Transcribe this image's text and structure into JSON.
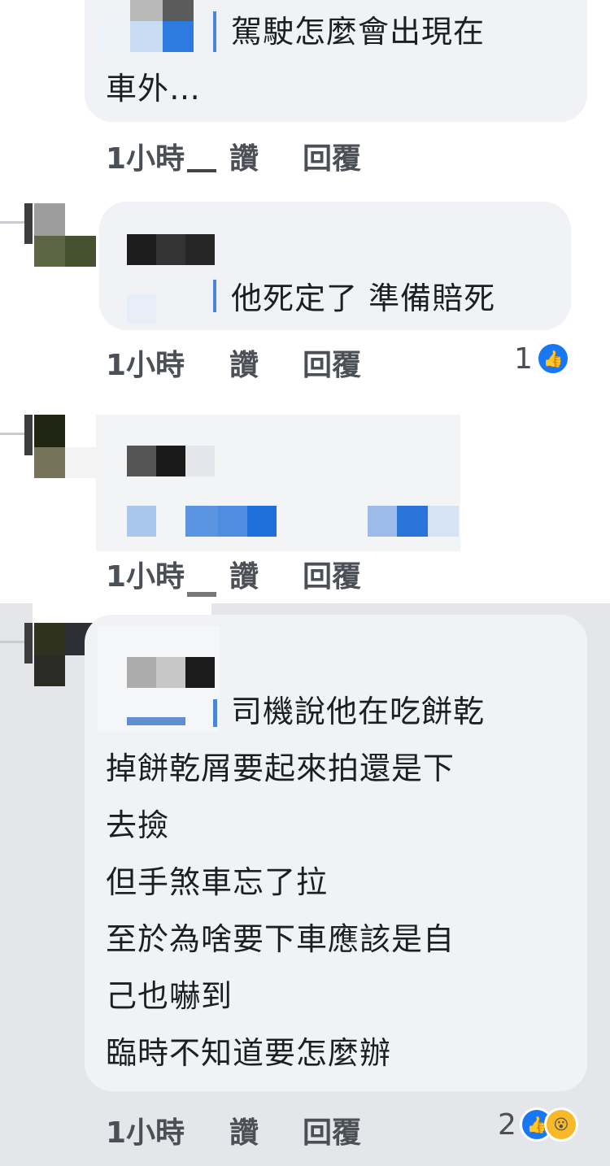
{
  "comments": [
    {
      "lines": [
        "駕駛怎麼會出現在",
        "車外…"
      ],
      "actions": {
        "time": "1小時",
        "like": "讚",
        "reply": "回覆"
      },
      "reactions": null
    },
    {
      "lines": [
        "他死定了 準備賠死"
      ],
      "actions": {
        "time": "1小時",
        "like": "讚",
        "reply": "回覆"
      },
      "reactions": {
        "count": "1",
        "icons": [
          "like-icon"
        ]
      }
    },
    {
      "lines": [],
      "actions": {
        "time": "1小時",
        "like": "讚",
        "reply": "回覆"
      },
      "reactions": null
    },
    {
      "lines": [
        "司機說他在吃餅乾",
        "掉餅乾屑要起來拍還是下",
        "去撿",
        "但手煞車忘了拉",
        "至於為啥要下車應該是自",
        "己也嚇到",
        "臨時不知道要怎麼辦"
      ],
      "actions": {
        "time": "1小時",
        "like": "讚",
        "reply": "回覆"
      },
      "reactions": {
        "count": "2",
        "icons": [
          "like-icon",
          "wow-icon"
        ]
      }
    }
  ],
  "colors": {
    "bubble": "#f0f2f5",
    "highlight_band": "#e4e6e9",
    "like_blue": "#1877f2",
    "wow_yellow": "#f7b928"
  }
}
